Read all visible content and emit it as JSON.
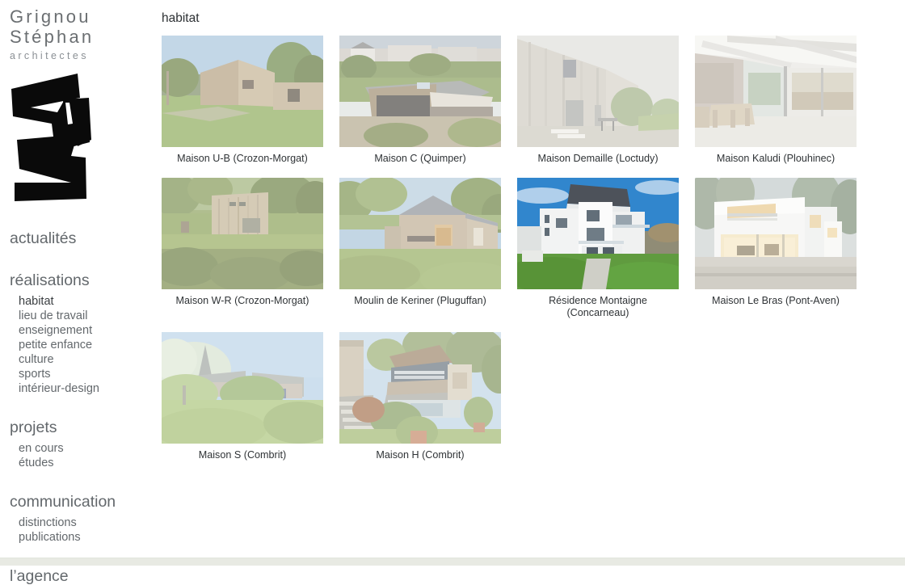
{
  "brand": {
    "line1": "Grignou",
    "line2": "Stéphan",
    "line3": "architectes",
    "logo_name": "gs-angular-logo"
  },
  "sidebar": {
    "sections": [
      {
        "label": "actualités",
        "items": []
      },
      {
        "label": "réalisations",
        "items": [
          "habitat",
          "lieu de travail",
          "enseignement",
          "petite enfance",
          "culture",
          "sports",
          "intérieur-design"
        ]
      },
      {
        "label": "projets",
        "items": [
          "en cours",
          "études"
        ]
      },
      {
        "label": "communication",
        "items": [
          "distinctions",
          "publications"
        ]
      },
      {
        "label": "l’agence",
        "items": []
      }
    ],
    "active_item": "habitat"
  },
  "main": {
    "title": "habitat",
    "projects": [
      {
        "caption": "Maison U-B (Crozon-Morgat)",
        "image": "wooden-house-lawn"
      },
      {
        "caption": "Maison C (Quimper)",
        "image": "aerial-house-awning"
      },
      {
        "caption": "Maison Demaille (Loctudy)",
        "image": "timber-facade-terrace"
      },
      {
        "caption": "Maison Kaludi (Plouhinec)",
        "image": "interior-beamed-ceiling"
      },
      {
        "caption": "Maison W-R (Crozon-Morgat)",
        "image": "timber-cube-trees"
      },
      {
        "caption": "Moulin de Keriner (Pluguffan)",
        "image": "stone-mill-barn"
      },
      {
        "caption": "Résidence Montaigne (Concarneau)",
        "image": "white-residence-blue-sky"
      },
      {
        "caption": "Maison Le Bras (Pont-Aven)",
        "image": "white-modern-house-dusk"
      },
      {
        "caption": "Maison S (Combrit)",
        "image": "garden-church-spire"
      },
      {
        "caption": "Maison H (Combrit)",
        "image": "hillside-house-steps"
      }
    ]
  },
  "colors": {
    "text": "#555a5e",
    "title": "#2c3033",
    "brand": "#6b6f72",
    "footer": "#e8eae3"
  }
}
